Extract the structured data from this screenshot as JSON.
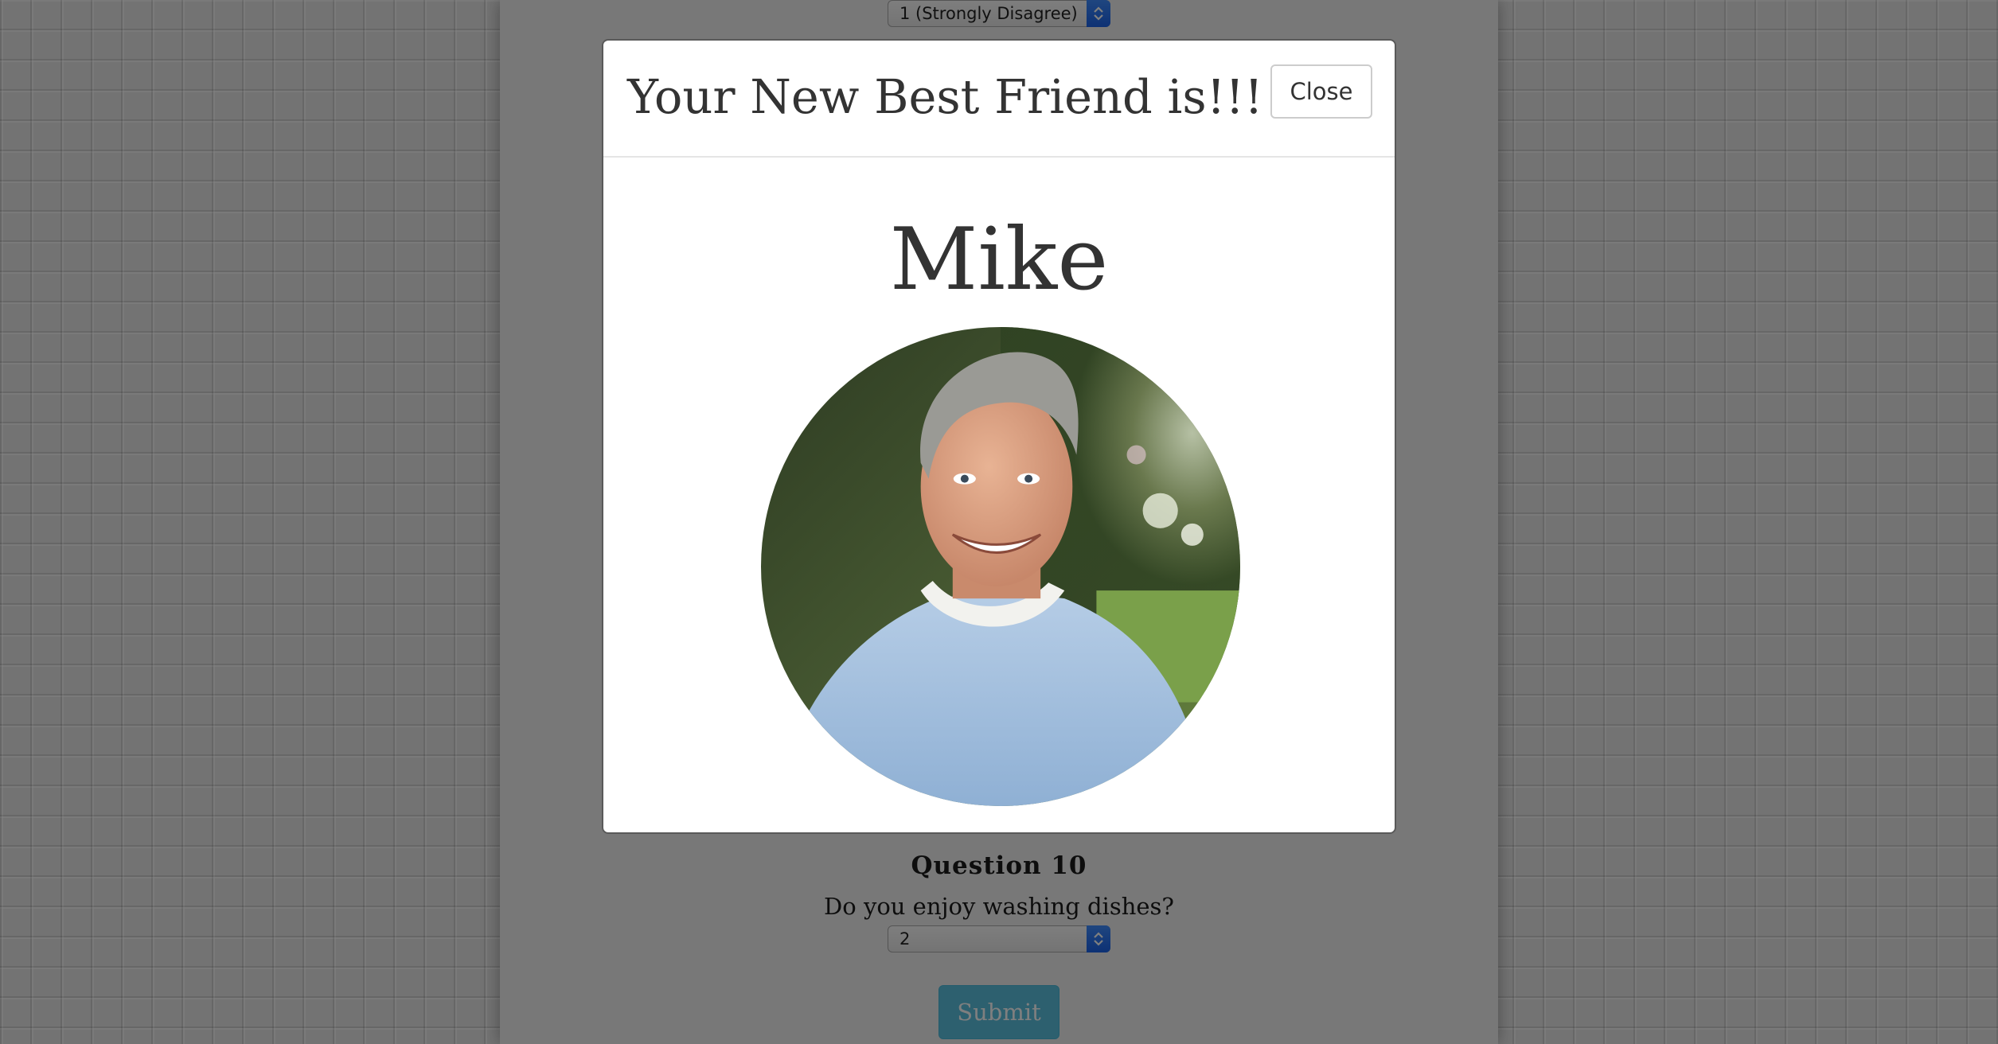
{
  "survey": {
    "prev_question_select": {
      "value": "1 (Strongly Disagree)"
    },
    "question": {
      "title": "Question 10",
      "text": "Do you enjoy washing dishes?",
      "select_value": "2"
    },
    "submit_label": "Submit"
  },
  "modal": {
    "title": "Your New Best Friend is!!!",
    "close_label": "Close",
    "friend_name": "Mike"
  },
  "colors": {
    "submit_bg": "#5bc0de",
    "select_arrow": "#1a62e8",
    "modal_text": "#333333"
  }
}
